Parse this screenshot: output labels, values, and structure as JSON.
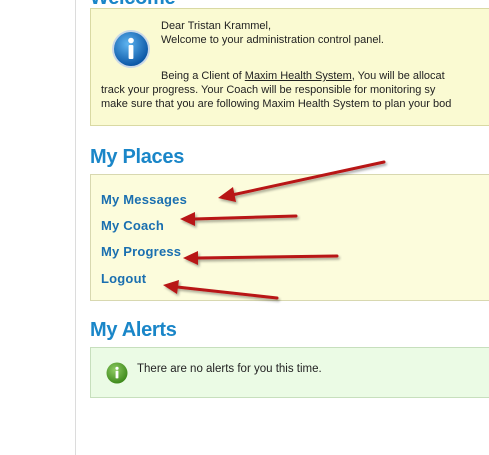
{
  "welcome": {
    "heading": "Welcome",
    "greeting": "Dear Tristan Krammel,",
    "intro": "Welcome to your administration control panel.",
    "para_before_link": "Being a Client of ",
    "para_link": "Maxim Health System",
    "para_after_link": ", You will be allocat",
    "para_line2": "track your progress. Your Coach will be responsible for monitoring sy",
    "para_line3": "make sure that you are following Maxim Health System to plan your bod"
  },
  "places": {
    "heading": "My Places",
    "links": [
      {
        "label": "My Messages"
      },
      {
        "label": "My Coach"
      },
      {
        "label": "My Progress"
      },
      {
        "label": "Logout"
      }
    ]
  },
  "alerts": {
    "heading": "My Alerts",
    "message": "There are no alerts for you this time."
  },
  "colors": {
    "heading": "#1a86c8",
    "link": "#1a6fb0",
    "arrow": "#b81414",
    "welcome_bg": "#fafad2",
    "alerts_bg": "#ebfbe5"
  },
  "icons": {
    "welcome": "info-icon",
    "alert": "info-icon-green",
    "annotation": "arrow-annotation"
  }
}
